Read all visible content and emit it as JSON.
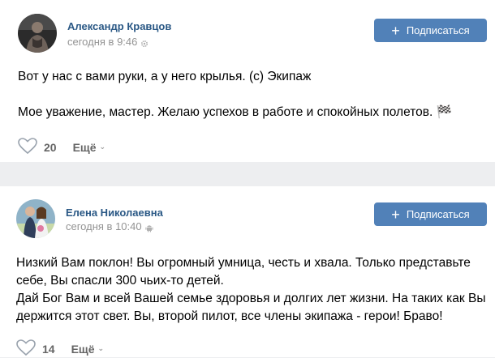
{
  "posts": [
    {
      "author": "Александр Кравцов",
      "time": "сегодня в 9:46",
      "meta_icon": "gear-icon",
      "subscribe_label": "Подписаться",
      "text": "Вот у нас с вами руки, а у него крылья. (с) Экипаж\n\nМое уважение, мастер. Желаю успехов в работе и спокойных полетов. 🏁",
      "likes": "20",
      "more_label": "Ещё"
    },
    {
      "author": "Елена Николаевна",
      "time": "сегодня в 10:40",
      "meta_icon": "android-icon",
      "subscribe_label": "Подписаться",
      "text": "Низкий Вам поклон! Вы огромный умница, честь и хвала. Только представьте себе, Вы спасли 300 чьих-то детей.\nДай Бог Вам и всей Вашей семье здоровья и долгих лет жизни. На таких как Вы держится этот свет. Вы, второй пилот, все члены экипажа - герои! Браво!",
      "likes": "14",
      "more_label": "Ещё"
    }
  ],
  "colors": {
    "accent": "#5181b8",
    "author": "#2a5885",
    "meta": "#939393",
    "background": "#edeef0"
  }
}
